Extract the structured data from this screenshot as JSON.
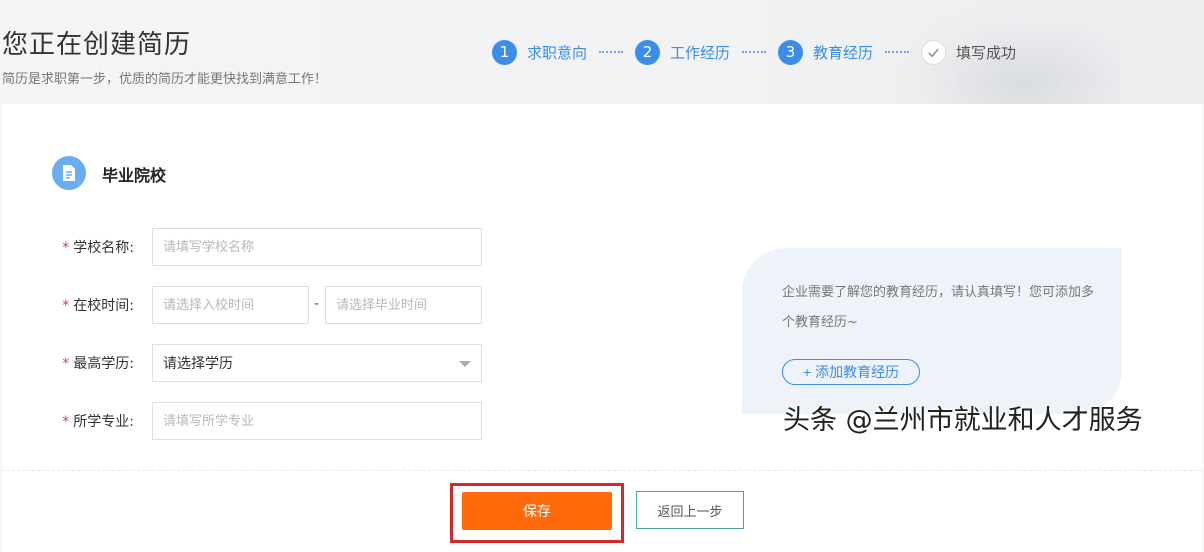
{
  "header": {
    "title": "您正在创建简历",
    "subtitle": "简历是求职第一步，优质的简历才能更快找到满意工作！"
  },
  "steps": [
    {
      "num": "1",
      "label": "求职意向"
    },
    {
      "num": "2",
      "label": "工作经历"
    },
    {
      "num": "3",
      "label": "教育经历"
    },
    {
      "icon": "check-icon",
      "label": "填写成功"
    }
  ],
  "section": {
    "icon": "document-icon",
    "title": "毕业院校"
  },
  "form": {
    "school_label": "学校名称:",
    "school_placeholder": "请填写学校名称",
    "time_label": "在校时间:",
    "start_placeholder": "请选择入校时间",
    "separator": "-",
    "end_placeholder": "请选择毕业时间",
    "degree_label": "最高学历:",
    "degree_value": "请选择学历",
    "major_label": "所学专业:",
    "major_placeholder": "请填写所学专业",
    "required_mark": "*"
  },
  "tip": {
    "text": "企业需要了解您的教育经历，请认真填写！您可添加多个教育经历~",
    "add_label": "+ 添加教育经历"
  },
  "actions": {
    "save_label": "保存",
    "back_label": "返回上一步"
  },
  "watermark": "头条 @兰州市就业和人才服务",
  "colors": {
    "accent": "#3b8de8",
    "save": "#ff6a0a",
    "highlight": "#d22a2a"
  }
}
